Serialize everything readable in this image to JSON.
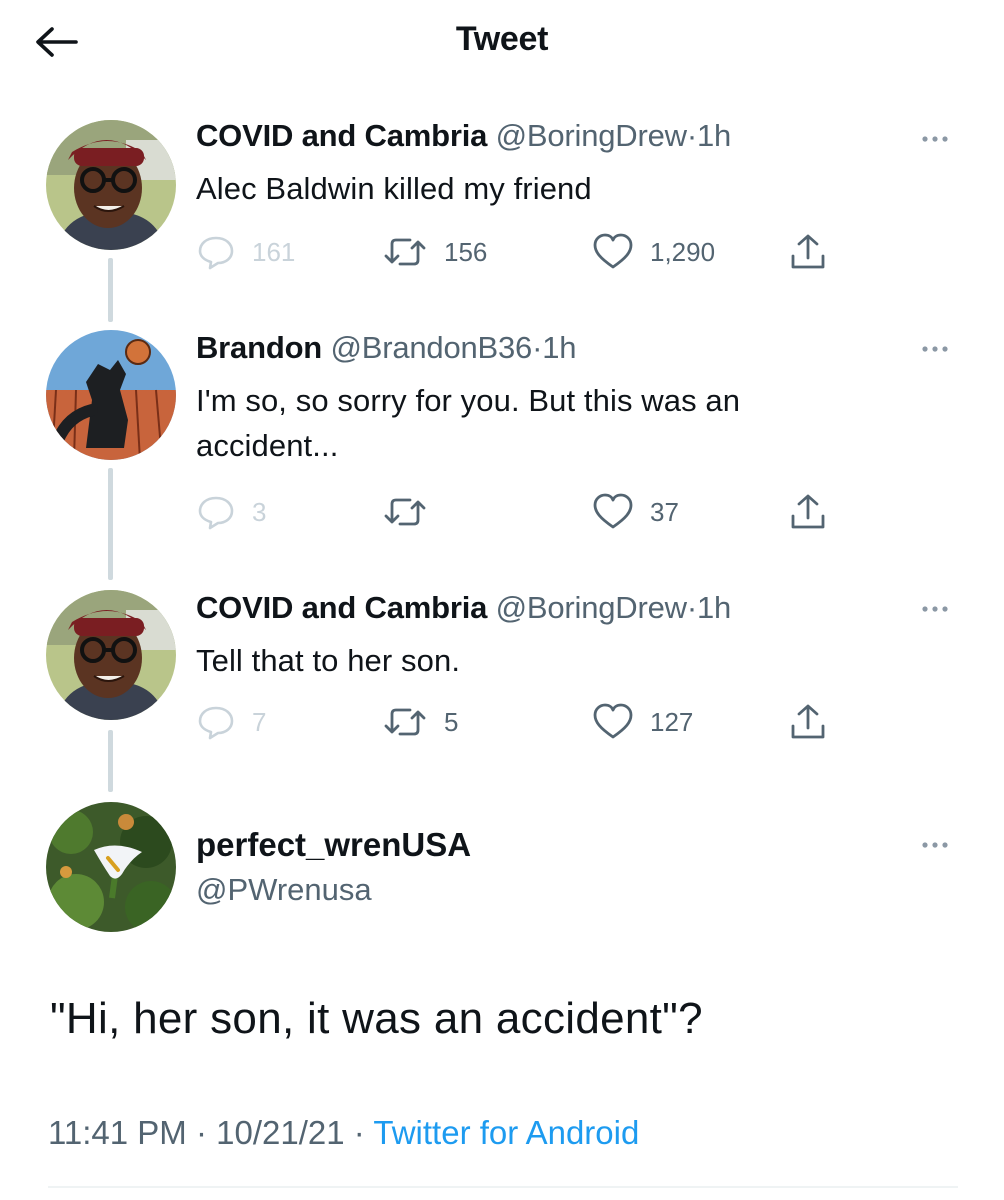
{
  "header": {
    "title": "Tweet",
    "back_icon": "arrow-left-icon"
  },
  "colors": {
    "text": "#0f1419",
    "secondary": "#536471",
    "link": "#1d9bf0",
    "thread_line": "#cfd9de"
  },
  "thread": [
    {
      "name": "COVID and Cambria",
      "handle": "@BoringDrew",
      "separator": "·",
      "time": "1h",
      "text": "Alec Baldwin killed my friend",
      "replies": "161",
      "retweets": "156",
      "likes": "1,290"
    },
    {
      "name": "Brandon",
      "handle": "@BrandonB36",
      "separator": "·",
      "time": "1h",
      "text": "I'm so, so sorry for you.  But this was an accident...",
      "replies": "3",
      "retweets": "",
      "likes": "37"
    },
    {
      "name": "COVID and Cambria",
      "handle": "@BoringDrew",
      "separator": "·",
      "time": "1h",
      "text": "Tell that to her son.",
      "replies": "7",
      "retweets": "5",
      "likes": "127"
    }
  ],
  "main_tweet": {
    "name": "perfect_wrenUSA",
    "handle": "@PWrenusa",
    "text": "\"Hi, her son, it was an accident\"?",
    "time": "11:41 PM",
    "date": "10/21/21",
    "separator": "·",
    "source": "Twitter for Android"
  }
}
